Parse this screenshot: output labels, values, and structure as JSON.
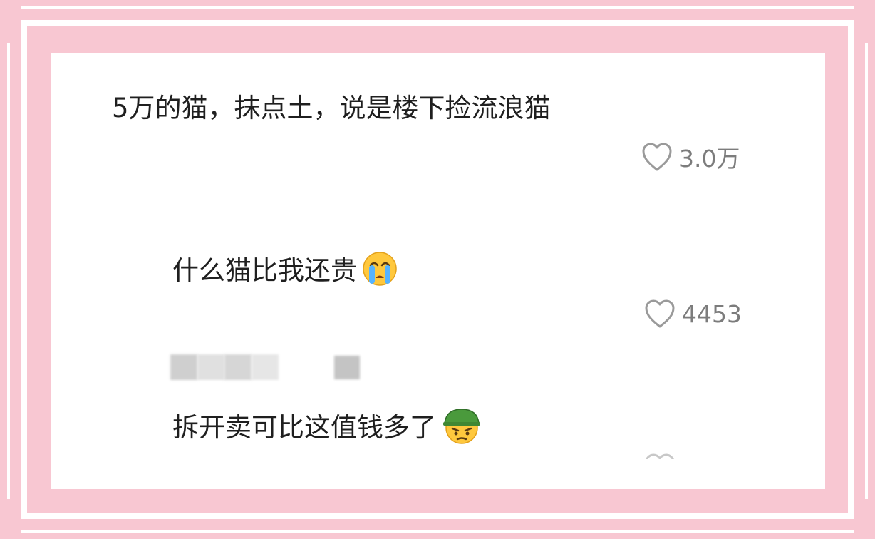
{
  "colors": {
    "frame_pink": "#f8c7d2",
    "text": "#1f1f1f",
    "muted": "#7c7c7c"
  },
  "comments": [
    {
      "text": "5万的猫，抹点土，说是楼下捡流浪猫",
      "likes": "3.0万",
      "icon": "heart-outline-icon"
    },
    {
      "text": "什么猫比我还贵",
      "emoji": "crying-face-emoji",
      "likes": "4453",
      "icon": "heart-outline-icon"
    },
    {
      "text": "拆开卖可比这值钱多了",
      "emoji": "soldier-helmet-angry-face-emoji",
      "icon": "heart-outline-icon"
    }
  ]
}
